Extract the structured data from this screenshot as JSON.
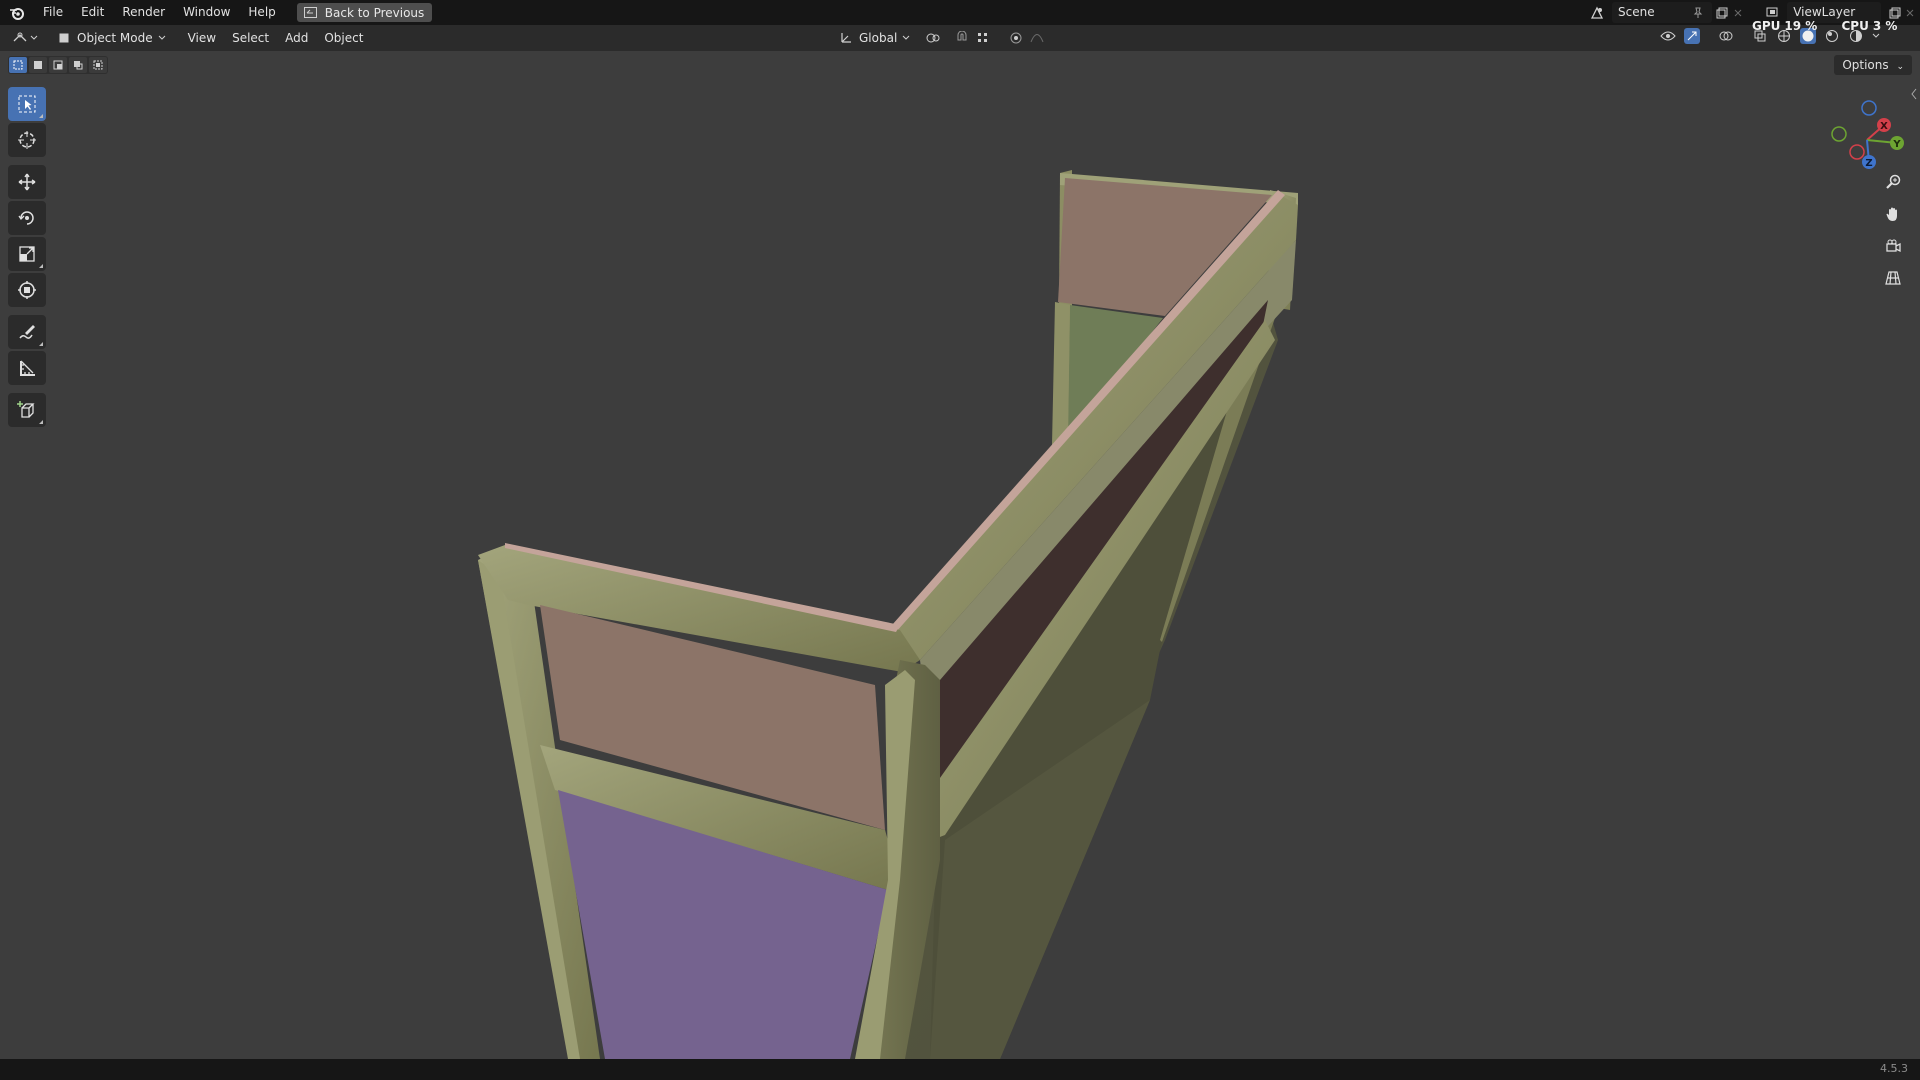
{
  "topbar": {
    "menus": [
      "File",
      "Edit",
      "Render",
      "Window",
      "Help"
    ],
    "back_button": "Back to Previous",
    "scene": "Scene",
    "view_layer": "ViewLayer",
    "gpu_label": "GPU",
    "gpu_value": "19 %",
    "cpu_label": "CPU",
    "cpu_value": "3 %"
  },
  "header": {
    "mode": "Object Mode",
    "menus": [
      "View",
      "Select",
      "Add",
      "Object"
    ],
    "transform_orientation": "Global"
  },
  "viewport": {
    "options_label": "Options",
    "gizmo_axes": [
      "X",
      "Y",
      "Z"
    ],
    "toolbar_tools": [
      "select-box",
      "cursor",
      "move",
      "rotate",
      "scale",
      "transform",
      "annotate",
      "measure",
      "add-cube"
    ]
  },
  "statusbar": {
    "version": "4.5.3"
  },
  "colors": {
    "frame": "#8a8a63",
    "panel_pink": "#8c7468",
    "panel_purple": "#75638f",
    "panel_green": "#6f7d57",
    "panel_dark": "#3e2f2d",
    "accent": "#4772b3"
  }
}
